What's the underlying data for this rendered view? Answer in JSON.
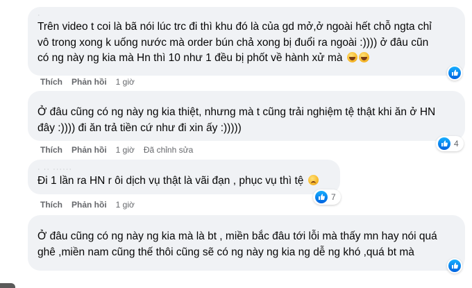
{
  "comments": [
    {
      "author": "· ",
      "lines": [
        "Trên video t coi là bã nói lúc trc đi thì khu đó là của gd mở,ở ngoài hết chỗ ngta chỉ",
        "vô trong xong k uống nước mà order bún chả xong bị đuổi ra ngoài :)))) ở đâu cũn",
        "có ng này ng kia mà Hn thì 10 như 1 đều bị phốt về hành xử mà"
      ],
      "emojis": [
        "laughing-face-icon",
        "laughing-face-icon"
      ],
      "like_label": "Thích",
      "reply_label": "Phản hồi",
      "time": "1 giờ",
      "reaction_count": ""
    },
    {
      "author": "",
      "lines": [
        "Ở đâu cũng có ng này ng kia thiệt, nhưng mà t cũng trải nghiệm tệ thật khi ăn ở HN",
        "đây :)))) đi ăn trả tiền cứ như đi xin ấy :)))))"
      ],
      "like_label": "Thích",
      "reply_label": "Phản hồi",
      "time": "1 giờ",
      "edited": "Đã chỉnh sửa",
      "reaction_count": "4"
    },
    {
      "author": "· ·· ······",
      "lines": [
        "Đi 1 lần ra HN r ôi dịch vụ thật là vãi đạn , phục vụ thì tệ"
      ],
      "emojis": [
        "sad-face-icon"
      ],
      "like_label": "Thích",
      "reply_label": "Phản hồi",
      "time": "1 giờ",
      "reaction_count": "7"
    },
    {
      "author": "",
      "lines": [
        "Ở đâu cũng có ng này ng kia mà là bt , miền bắc đâu tới lỗi mà thấy mn hay nói quá",
        "ghê ,miền nam cũng thế thôi cũng sẽ có ng này ng kia ng dễ ng khó ,quá bt mà"
      ],
      "reaction_count": ""
    }
  ],
  "colors": {
    "bubble": "#f0f2f5",
    "text": "#050505",
    "meta": "#65676b",
    "like_blue": "#0866ff"
  }
}
